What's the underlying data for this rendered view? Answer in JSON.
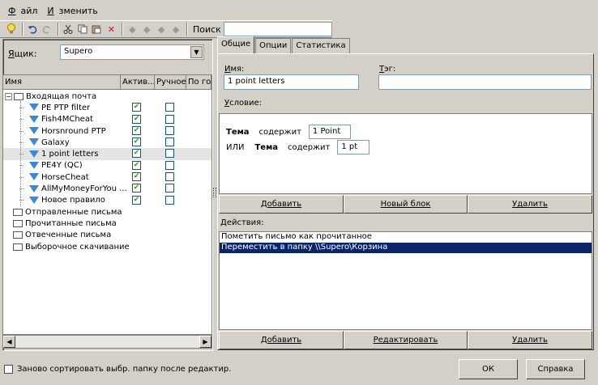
{
  "menu": {
    "items": [
      {
        "label": "Файл",
        "underline": "Ф",
        "rest": "айл"
      },
      {
        "label": "Изменить",
        "underline": "И",
        "rest": "зменить"
      }
    ]
  },
  "toolbar": {
    "search_label": "Поиск",
    "search_value": ""
  },
  "mailbox": {
    "label": "Ящик:",
    "selected": "Supero"
  },
  "rules_table": {
    "headers": [
      "Имя",
      "Актив...",
      "Ручное",
      "По гор"
    ],
    "rows": [
      {
        "name": "Входящая почта",
        "type": "folder",
        "expanded": true
      },
      {
        "name": "PE PTP filter",
        "type": "rule",
        "active": true,
        "manual": false
      },
      {
        "name": "Fish4MCheat",
        "type": "rule",
        "active": true,
        "manual": false
      },
      {
        "name": "Horsnround PTP",
        "type": "rule",
        "active": true,
        "manual": false
      },
      {
        "name": "Galaxy",
        "type": "rule",
        "active": true,
        "manual": false
      },
      {
        "name": "1 point letters",
        "type": "rule",
        "active": true,
        "manual": false,
        "selected": true
      },
      {
        "name": "PE4Y (QC)",
        "type": "rule",
        "active": true,
        "manual": false
      },
      {
        "name": "HorseCheat",
        "type": "rule",
        "active": true,
        "manual": false
      },
      {
        "name": "AllMyMoneyForYou ...",
        "type": "rule",
        "active": true,
        "manual": false
      },
      {
        "name": "Новое правило",
        "type": "rule",
        "active": true,
        "manual": false
      },
      {
        "name": "Отправленные письма",
        "type": "folder"
      },
      {
        "name": "Прочитанные письма",
        "type": "folder"
      },
      {
        "name": "Отвеченные письма",
        "type": "folder"
      },
      {
        "name": "Выборочное скачивание",
        "type": "folder"
      }
    ]
  },
  "tabs": [
    "Общие",
    "Опции",
    "Статистика"
  ],
  "general": {
    "name_label": "Имя:",
    "name_value": "1 point letters",
    "tag_label": "Тэг:",
    "tag_value": "",
    "condition_label": "Условие:",
    "condition_lines": [
      {
        "prefix": "",
        "field": "Тема",
        "op": "содержит",
        "value": "1 Point"
      },
      {
        "prefix": "ИЛИ",
        "field": "Тема",
        "op": "содержит",
        "value": "1 pt"
      }
    ],
    "condition_buttons": [
      "Добавить",
      "Новый блок",
      "Удалить"
    ],
    "actions_label": "Действия:",
    "actions": [
      {
        "text": "Пометить письмо как прочитанное",
        "selected": false
      },
      {
        "text": "Переместить в папку \\\\Supero\\Корзина",
        "selected": true
      }
    ],
    "action_buttons": [
      "Добавить",
      "Редактировать",
      "Удалить"
    ]
  },
  "footer": {
    "resort_label": "Заново сортировать выбр. папку после редактир.",
    "resort_checked": false,
    "ok_label": "ОК",
    "help_label": "Справка"
  }
}
